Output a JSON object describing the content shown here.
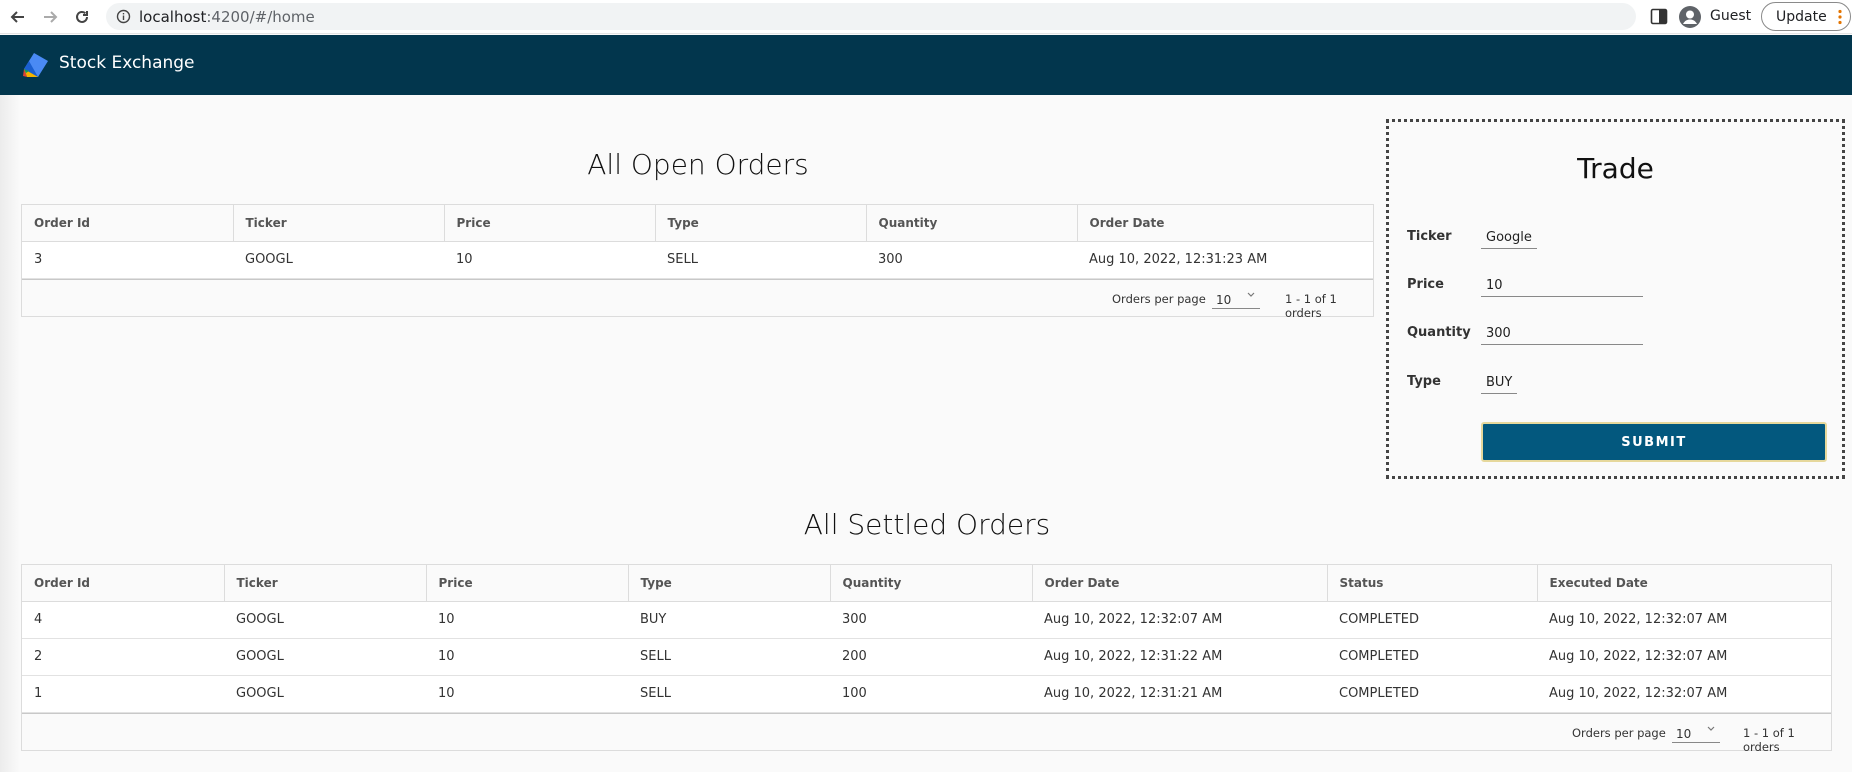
{
  "browser": {
    "url_host": "localhost",
    "url_path": ":4200/#/home",
    "profile_label": "Guest",
    "update_label": "Update"
  },
  "app": {
    "title": "Stock Exchange"
  },
  "open_orders": {
    "title": "All Open Orders",
    "columns": [
      "Order Id",
      "Ticker",
      "Price",
      "Type",
      "Quantity",
      "Order Date"
    ],
    "rows": [
      [
        "3",
        "GOOGL",
        "10",
        "SELL",
        "300",
        "Aug 10, 2022, 12:31:23 AM"
      ]
    ],
    "paginator": {
      "label": "Orders per page",
      "page_size": "10",
      "range": "1 - 1 of 1 orders"
    }
  },
  "settled_orders": {
    "title": "All Settled Orders",
    "columns": [
      "Order Id",
      "Ticker",
      "Price",
      "Type",
      "Quantity",
      "Order Date",
      "Status",
      "Executed Date"
    ],
    "rows": [
      [
        "4",
        "GOOGL",
        "10",
        "BUY",
        "300",
        "Aug 10, 2022, 12:32:07 AM",
        "COMPLETED",
        "Aug 10, 2022, 12:32:07 AM"
      ],
      [
        "2",
        "GOOGL",
        "10",
        "SELL",
        "200",
        "Aug 10, 2022, 12:31:22 AM",
        "COMPLETED",
        "Aug 10, 2022, 12:32:07 AM"
      ],
      [
        "1",
        "GOOGL",
        "10",
        "SELL",
        "100",
        "Aug 10, 2022, 12:31:21 AM",
        "COMPLETED",
        "Aug 10, 2022, 12:32:07 AM"
      ]
    ],
    "paginator": {
      "label": "Orders per page",
      "page_size": "10",
      "range": "1 - 1 of 1 orders"
    }
  },
  "trade": {
    "title": "Trade",
    "ticker_label": "Ticker",
    "ticker_value": "Google",
    "price_label": "Price",
    "price_value": "10",
    "quantity_label": "Quantity",
    "quantity_value": "300",
    "type_label": "Type",
    "type_value": "BUY",
    "submit_label": "SUBMIT"
  },
  "colors": {
    "toolbar": "#02364d",
    "submit": "#03587e"
  }
}
